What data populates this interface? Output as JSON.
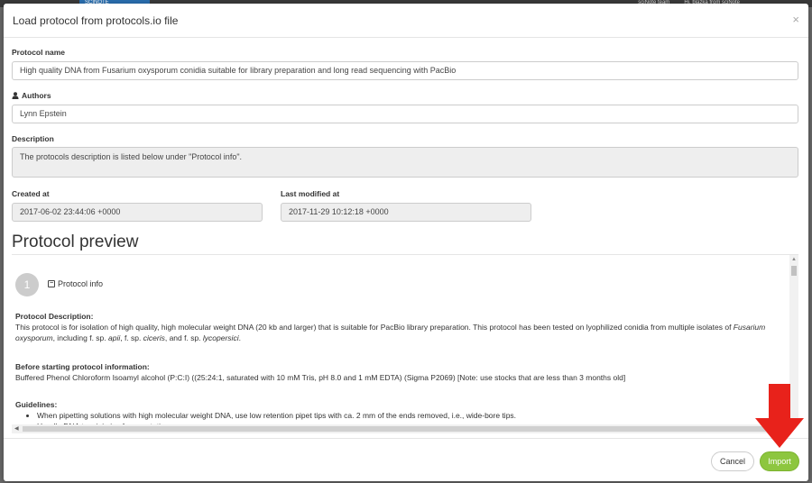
{
  "background": {
    "logo_text": "SCINOTE",
    "nav_items": [
      "sciNote team",
      "Hi, blazka from sciNote"
    ]
  },
  "modal": {
    "title": "Load protocol from protocols.io file",
    "close_glyph": "×",
    "protocol_name": {
      "label": "Protocol name",
      "value": "High quality DNA from Fusarium oxysporum conidia suitable for library preparation and long read sequencing with PacBio"
    },
    "authors": {
      "label": "Authors",
      "value": "Lynn Epstein"
    },
    "description": {
      "label": "Description",
      "value": "The protocols description is listed below under \"Protocol info\"."
    },
    "created_at": {
      "label": "Created at",
      "value": "2017-06-02 23:44:06 +0000"
    },
    "last_modified": {
      "label": "Last modified at",
      "value": "2017-11-29 10:12:18 +0000"
    },
    "preview_title": "Protocol preview",
    "step": {
      "number": "1",
      "toggle_glyph": "−",
      "title": "Protocol info",
      "desc_heading": "Protocol Description:",
      "desc_text_1": "This protocol is for isolation of high quality, high molecular weight DNA (20 kb and larger) that is suitable for PacBio library preparation. This protocol has been tested on lyophilized conidia from multiple isolates of ",
      "desc_italic_1": "Fusarium oxysporum",
      "desc_text_2": ", including f. sp. ",
      "desc_italic_2": "apii",
      "desc_text_3": ", f. sp. ",
      "desc_italic_3": "ciceris",
      "desc_text_4": ", and f. sp. ",
      "desc_italic_4": "lycopersici",
      "desc_text_5": ".",
      "before_heading": "Before starting protocol information:",
      "before_text": "Buffered Phenol Chloroform Isoamyl alcohol (P:C:I) ((25:24:1, saturated with 10 mM Tris, pH 8.0 and 1 mM EDTA) (Sigma P2069) [Note: use stocks that are less than 3 months old]",
      "guidelines_heading": "Guidelines:",
      "guidelines": [
        "When pipetting solutions with high molecular weight DNA, use low retention pipet tips with ca. 2 mm of the ends removed, i.e., wide-bore tips.",
        "Handle DNA to minimize fragmentation."
      ]
    },
    "footer": {
      "cancel_label": "Cancel",
      "import_label": "Import"
    }
  },
  "annotation": {
    "arrow_color": "#e8221b"
  }
}
